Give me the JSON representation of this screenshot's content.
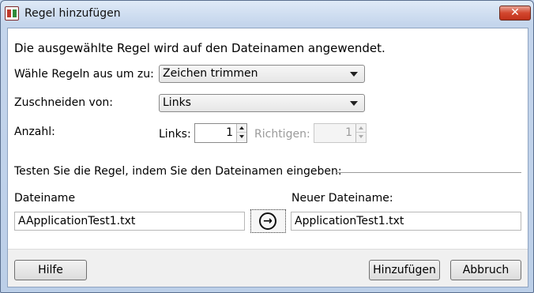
{
  "window": {
    "title": "Regel hinzufügen",
    "close_glyph": "✕"
  },
  "intro": "Die ausgewählte Regel wird auf den Dateinamen angewendet.",
  "rule_select": {
    "label": "Wähle Regeln aus um zu:",
    "value": "Zeichen trimmen"
  },
  "trim_select": {
    "label": "Zuschneiden von:",
    "value": "Links"
  },
  "count": {
    "label": "Anzahl:",
    "left_label": "Links:",
    "left_value": "1",
    "right_label": "Richtigen:",
    "right_value": "1"
  },
  "test_group": {
    "title": "Testen Sie die Regel, indem Sie den Dateinamen eingeben:",
    "filename_label": "Dateiname",
    "filename_value": "AApplicationTest1.txt",
    "new_filename_label": "Neuer Dateiname:",
    "new_filename_value": "ApplicationTest1.txt",
    "go_glyph": "→"
  },
  "buttons": {
    "help": "Hilfe",
    "add": "Hinzufügen",
    "cancel": "Abbruch"
  }
}
